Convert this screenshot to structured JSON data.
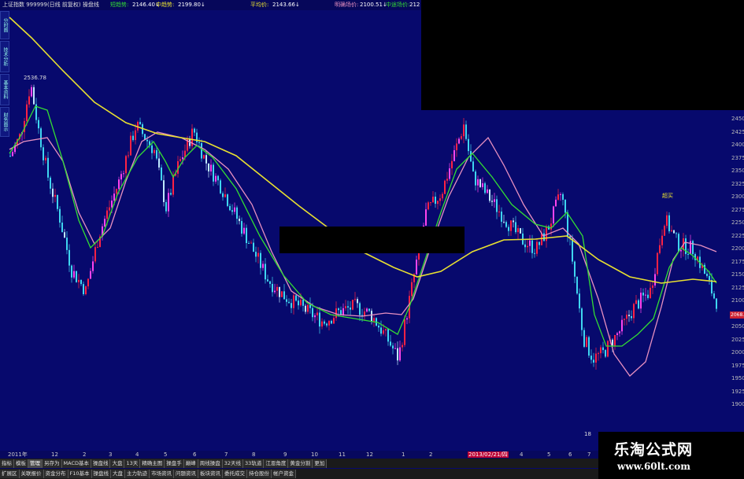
{
  "header": {
    "index_title": "上证指数 999999(日线 前复权) 操盘线",
    "items": [
      {
        "label": "短趋势:",
        "value": "2146.40↓"
      },
      {
        "label": "中趋势:",
        "value": "2199.80↓"
      },
      {
        "label": "平均价:",
        "value": "2143.66↓"
      },
      {
        "label": "明确场价:",
        "value": "2100.51↓"
      }
    ],
    "extra_label": "中途场价:",
    "extra_value": "212"
  },
  "left_tabs": [
    "分时图",
    "技术分析",
    "基本资料",
    "财务图示"
  ],
  "chart_annotations": {
    "high_label": "2536.78",
    "buy_label": "超买",
    "low_label": "18"
  },
  "y_axis": {
    "ticks": [
      "2450",
      "2425",
      "2400",
      "2375",
      "2350",
      "2325",
      "2300",
      "2275",
      "2250",
      "2225",
      "2200",
      "2175",
      "2150",
      "2125",
      "2100",
      "2075",
      "2050",
      "2025",
      "2000",
      "1975",
      "1950",
      "1925",
      "1900"
    ],
    "current_price": "2068.6"
  },
  "x_axis": {
    "ticks": [
      "2011年",
      "12",
      "2",
      "3",
      "4",
      "5",
      "6",
      "7",
      "8",
      "9",
      "10",
      "11",
      "12",
      "1",
      "2",
      "2013/02/21/四",
      "4",
      "5",
      "6",
      "7"
    ]
  },
  "tabs_row1": [
    "指标",
    "模板",
    "管理",
    "另存为",
    "MACD基本",
    "操盘线",
    "大盘",
    "13天",
    "精确主图",
    "操盘手",
    "巅峰",
    "周线操盘",
    "32天线",
    "33轨道",
    "江恩角度",
    "黄金分割",
    "更加"
  ],
  "tabs_row1_active": "管理",
  "tabs_row2": [
    "扩展区",
    "关联报价",
    "资金分布",
    "F10基本",
    "操盘线",
    "大盘",
    "主力轨迹",
    "市场资讯",
    "问题资讯",
    "板块资讯",
    "委托成交",
    "持仓股份",
    "帐户资金"
  ],
  "watermark": {
    "title": "乐淘公式网",
    "url": "www.60lt.com"
  },
  "colors": {
    "background": "#07096d",
    "ma_yellow": "#e8e030",
    "ma_green": "#33dd33",
    "ma_pink": "#e890c0",
    "candle_cyan": "#3fd6f0",
    "candle_red": "#ff2244",
    "candle_magenta": "#ff44ee"
  }
}
